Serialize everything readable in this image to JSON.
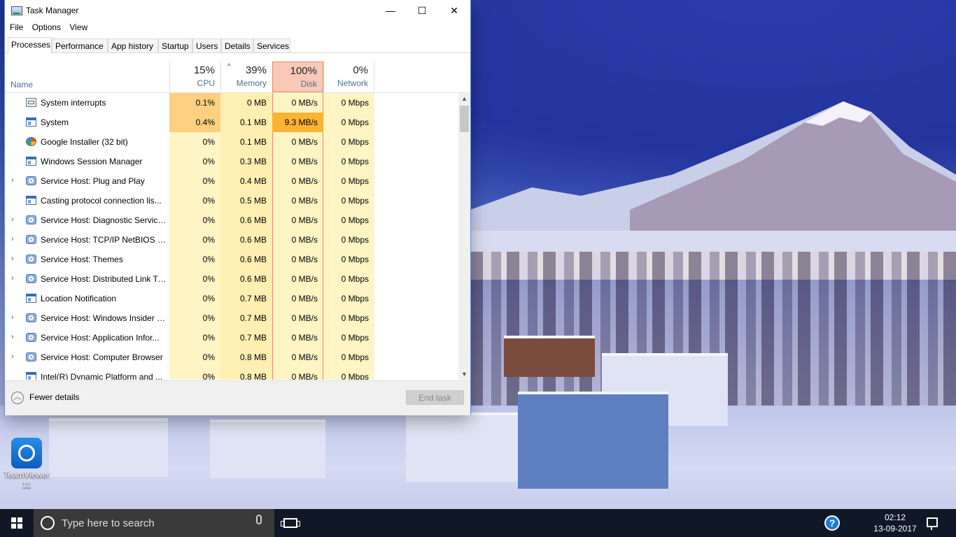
{
  "window": {
    "title": "Task Manager",
    "controls": {
      "minimize": "—",
      "maximize": "☐",
      "close": "✕"
    }
  },
  "menu": [
    "File",
    "Options",
    "View"
  ],
  "tabs": [
    "Processes",
    "Performance",
    "App history",
    "Startup",
    "Users",
    "Details",
    "Services"
  ],
  "active_tab": "Processes",
  "columns": {
    "name": "Name",
    "cpu": {
      "pct": "15%",
      "label": "CPU"
    },
    "memory": {
      "pct": "39%",
      "label": "Memory"
    },
    "disk": {
      "pct": "100%",
      "label": "Disk"
    },
    "network": {
      "pct": "0%",
      "label": "Network"
    }
  },
  "processes": [
    {
      "name": "System interrupts",
      "icon": "interrupts-icon",
      "expandable": false,
      "cpu": "0.1%",
      "memory": "0 MB",
      "disk": "0 MB/s",
      "network": "0 Mbps"
    },
    {
      "name": "System",
      "icon": "window-icon",
      "expandable": false,
      "cpu": "0.4%",
      "memory": "0.1 MB",
      "disk": "9.3 MB/s",
      "network": "0 Mbps"
    },
    {
      "name": "Google Installer (32 bit)",
      "icon": "installer-icon",
      "expandable": false,
      "cpu": "0%",
      "memory": "0.1 MB",
      "disk": "0 MB/s",
      "network": "0 Mbps"
    },
    {
      "name": "Windows Session Manager",
      "icon": "window-icon",
      "expandable": false,
      "cpu": "0%",
      "memory": "0.3 MB",
      "disk": "0 MB/s",
      "network": "0 Mbps"
    },
    {
      "name": "Service Host: Plug and Play",
      "icon": "gear-icon",
      "expandable": true,
      "cpu": "0%",
      "memory": "0.4 MB",
      "disk": "0 MB/s",
      "network": "0 Mbps"
    },
    {
      "name": "Casting protocol connection lis...",
      "icon": "window-icon",
      "expandable": false,
      "cpu": "0%",
      "memory": "0.5 MB",
      "disk": "0 MB/s",
      "network": "0 Mbps"
    },
    {
      "name": "Service Host: Diagnostic Service...",
      "icon": "gear-icon",
      "expandable": true,
      "cpu": "0%",
      "memory": "0.6 MB",
      "disk": "0 MB/s",
      "network": "0 Mbps"
    },
    {
      "name": "Service Host: TCP/IP NetBIOS H...",
      "icon": "gear-icon",
      "expandable": true,
      "cpu": "0%",
      "memory": "0.6 MB",
      "disk": "0 MB/s",
      "network": "0 Mbps"
    },
    {
      "name": "Service Host: Themes",
      "icon": "gear-icon",
      "expandable": true,
      "cpu": "0%",
      "memory": "0.6 MB",
      "disk": "0 MB/s",
      "network": "0 Mbps"
    },
    {
      "name": "Service Host: Distributed Link Tr...",
      "icon": "gear-icon",
      "expandable": true,
      "cpu": "0%",
      "memory": "0.6 MB",
      "disk": "0 MB/s",
      "network": "0 Mbps"
    },
    {
      "name": "Location Notification",
      "icon": "window-icon",
      "expandable": false,
      "cpu": "0%",
      "memory": "0.7 MB",
      "disk": "0 MB/s",
      "network": "0 Mbps"
    },
    {
      "name": "Service Host: Windows Insider S...",
      "icon": "gear-icon",
      "expandable": true,
      "cpu": "0%",
      "memory": "0.7 MB",
      "disk": "0 MB/s",
      "network": "0 Mbps"
    },
    {
      "name": "Service Host: Application Infor...",
      "icon": "gear-icon",
      "expandable": true,
      "cpu": "0%",
      "memory": "0.7 MB",
      "disk": "0 MB/s",
      "network": "0 Mbps"
    },
    {
      "name": "Service Host: Computer Browser",
      "icon": "gear-icon",
      "expandable": true,
      "cpu": "0%",
      "memory": "0.8 MB",
      "disk": "0 MB/s",
      "network": "0 Mbps"
    },
    {
      "name": "Intel(R) Dynamic Platform and ...",
      "icon": "window-icon",
      "expandable": false,
      "cpu": "0%",
      "memory": "0.8 MB",
      "disk": "0 MB/s",
      "network": "0 Mbps"
    }
  ],
  "footer": {
    "fewer_details": "Fewer details",
    "end_task": "End task"
  },
  "desktop": {
    "icon_label": "TeamViewer 11"
  },
  "taskbar": {
    "search_placeholder": "Type here to search",
    "time": "02:12",
    "date": "13-09-2017"
  },
  "colors": {
    "disk_header_bg": "#f8c9b6",
    "cell_light": "#fff4c4",
    "cell_mid": "#ffefb0",
    "cell_hot": "#fcd080",
    "cell_hotter": "#fbb332",
    "taskbar": "#101828",
    "accent": "#1e7bd6"
  }
}
